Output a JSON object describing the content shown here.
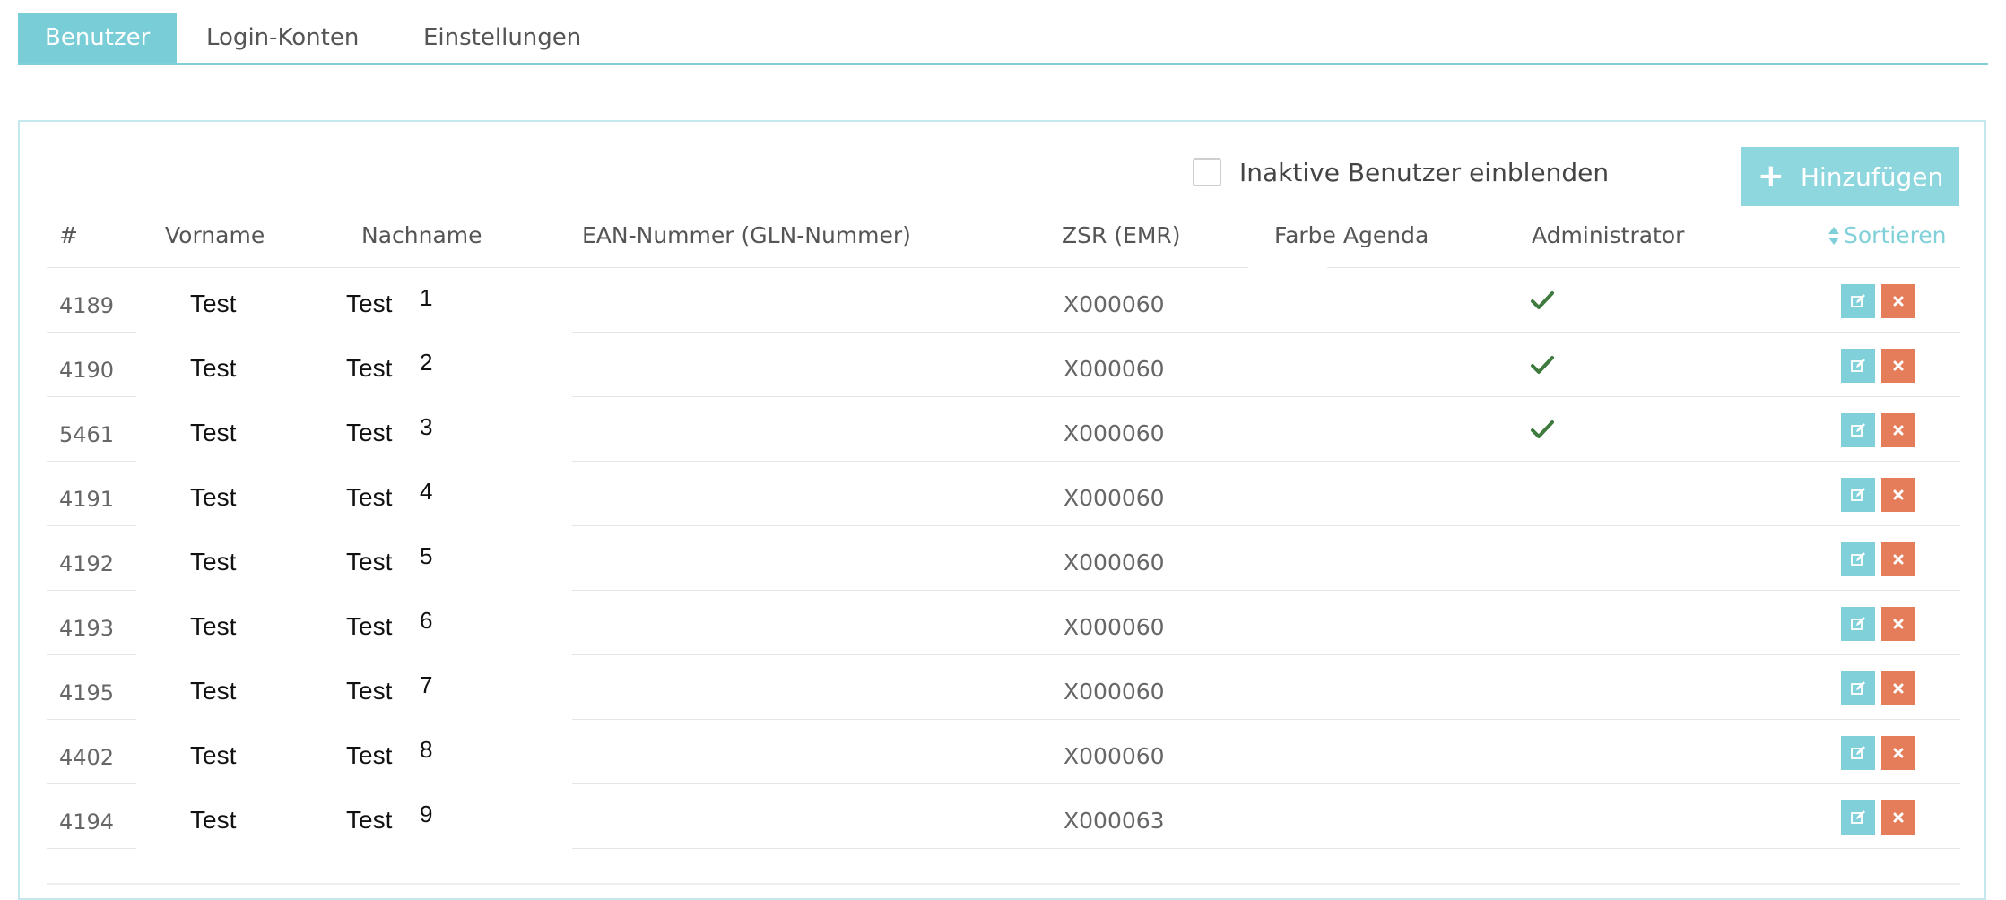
{
  "tabs": [
    {
      "label": "Benutzer",
      "active": true
    },
    {
      "label": "Login-Konten",
      "active": false
    },
    {
      "label": "Einstellungen",
      "active": false
    }
  ],
  "filter": {
    "show_inactive_label": "Inaktive Benutzer einblenden",
    "checked": false
  },
  "toolbar": {
    "add_label": "Hinzufügen",
    "add_icon": "plus-icon"
  },
  "table": {
    "headers": {
      "id": "#",
      "first_name": "Vorname",
      "last_name": "Nachname",
      "ean": "EAN-Nummer (GLN-Nummer)",
      "zsr": "ZSR (EMR)",
      "color": "Farbe Agenda",
      "admin": "Administrator",
      "sort": "Sortieren",
      "sort_icon": "sort-icon"
    },
    "rows": [
      {
        "id": "4189",
        "first_name": "Test",
        "last_name": "Test",
        "num": "1",
        "ean": "",
        "zsr": "X000060",
        "color": "",
        "admin": true
      },
      {
        "id": "4190",
        "first_name": "Test",
        "last_name": "Test",
        "num": "2",
        "ean": "",
        "zsr": "X000060",
        "color": "",
        "admin": true
      },
      {
        "id": "5461",
        "first_name": "Test",
        "last_name": "Test",
        "num": "3",
        "ean": "",
        "zsr": "X000060",
        "color": "",
        "admin": true
      },
      {
        "id": "4191",
        "first_name": "Test",
        "last_name": "Test",
        "num": "4",
        "ean": "",
        "zsr": "X000060",
        "color": "",
        "admin": false
      },
      {
        "id": "4192",
        "first_name": "Test",
        "last_name": "Test",
        "num": "5",
        "ean": "",
        "zsr": "X000060",
        "color": "",
        "admin": false
      },
      {
        "id": "4193",
        "first_name": "Test",
        "last_name": "Test",
        "num": "6",
        "ean": "",
        "zsr": "X000060",
        "color": "",
        "admin": false
      },
      {
        "id": "4195",
        "first_name": "Test",
        "last_name": "Test",
        "num": "7",
        "ean": "",
        "zsr": "X000060",
        "color": "",
        "admin": false
      },
      {
        "id": "4402",
        "first_name": "Test",
        "last_name": "Test",
        "num": "8",
        "ean": "",
        "zsr": "X000060",
        "color": "",
        "admin": false
      },
      {
        "id": "4194",
        "first_name": "Test",
        "last_name": "Test",
        "num": "9",
        "ean": "",
        "zsr": "X000063",
        "color": "",
        "admin": false
      }
    ],
    "row_actions": {
      "edit_icon": "edit-icon",
      "delete_icon": "delete-icon"
    }
  },
  "colors": {
    "accent": "#7fd0d8",
    "add_button": "#8ed7de",
    "delete": "#e57c5a",
    "check": "#3f7a3f"
  }
}
